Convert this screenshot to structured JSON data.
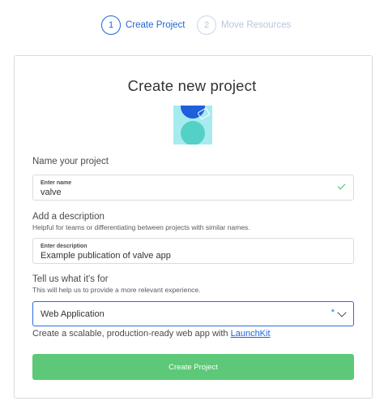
{
  "stepper": {
    "steps": [
      {
        "number": "1",
        "label": "Create Project",
        "state": "active"
      },
      {
        "number": "2",
        "label": "Move Resources",
        "state": "inactive"
      }
    ]
  },
  "form": {
    "title": "Create new project",
    "name": {
      "label": "Name your project",
      "caption": "Enter name",
      "value": "valve",
      "valid_icon": "check-icon"
    },
    "description": {
      "label": "Add a description",
      "help": "Helpful for teams or differentiating between projects with similar names.",
      "caption": "Enter description",
      "value": "Example publication of valve app"
    },
    "purpose": {
      "label": "Tell us what it's for",
      "help": "This will help us to provide a more relevant experience.",
      "selected": "Web Application",
      "required_mark": "*",
      "note_text": "Create a scalable, production-ready web app with ",
      "note_link": "LaunchKit"
    },
    "submit_label": "Create Project"
  },
  "colors": {
    "accent": "#1f65d6",
    "button": "#5cc878",
    "valid": "#3fbf6b",
    "illustration_bg": "#a7ebee"
  }
}
